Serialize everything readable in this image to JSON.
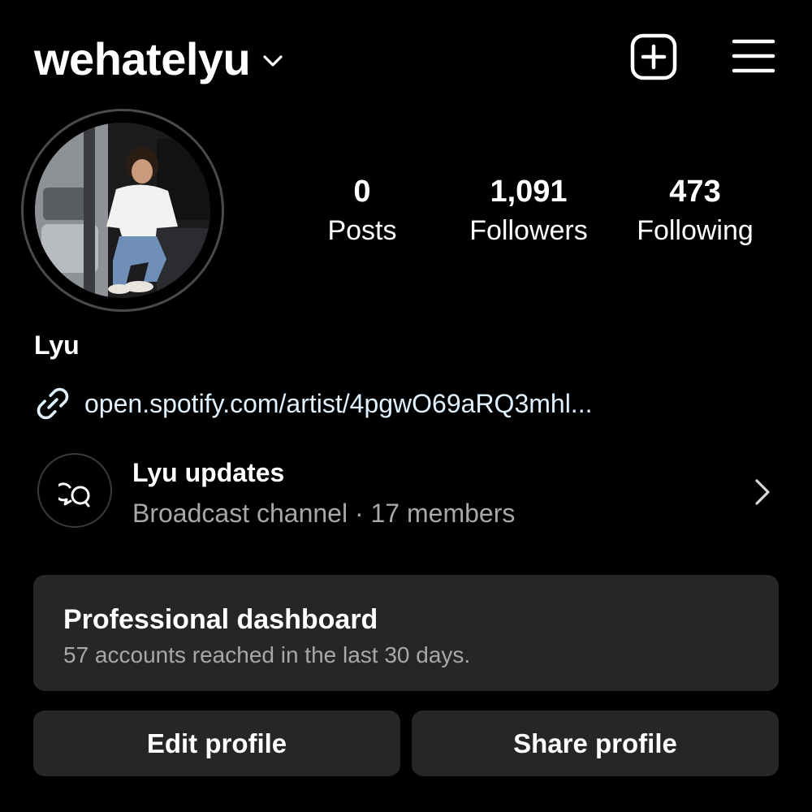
{
  "header": {
    "username": "wehatelyu"
  },
  "stats": {
    "posts": {
      "value": "0",
      "label": "Posts"
    },
    "followers": {
      "value": "1,091",
      "label": "Followers"
    },
    "following": {
      "value": "473",
      "label": "Following"
    }
  },
  "profile": {
    "display_name": "Lyu",
    "link": "open.spotify.com/artist/4pgwO69aRQ3mhl..."
  },
  "channel": {
    "title": "Lyu updates",
    "subtitle": "Broadcast channel · 17 members"
  },
  "dashboard": {
    "title": "Professional dashboard",
    "subtitle": "57 accounts reached in the last 30 days."
  },
  "buttons": {
    "edit": "Edit profile",
    "share": "Share profile"
  },
  "icons": {
    "chevron": "chevron-down-icon",
    "add": "add-post-icon",
    "menu": "hamburger-menu-icon",
    "link": "link-icon",
    "channel": "broadcast-channel-icon",
    "arrow": "chevron-right-icon"
  },
  "colors": {
    "background": "#000000",
    "card": "#262626",
    "secondary_text": "#a8a8a8",
    "link_text": "#e0f1ff"
  }
}
